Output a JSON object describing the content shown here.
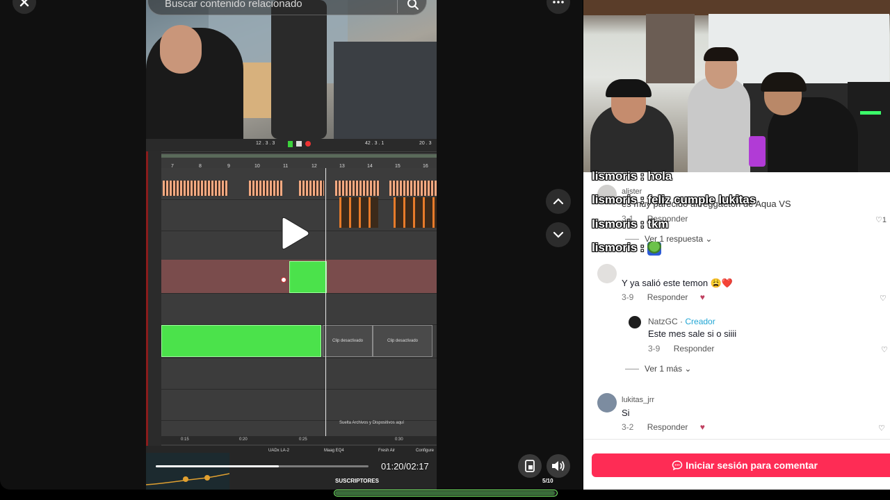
{
  "video": {
    "search_placeholder": "Buscar contenido relacionado",
    "time_current": "01:20",
    "time_total": "02:17",
    "progress": 0.58,
    "bottom_label": "SUSCRIPTORES",
    "page_counter": "5/10",
    "daw": {
      "ruler_ticks": [
        "7",
        "8",
        "9",
        "10",
        "11",
        "12",
        "13",
        "14",
        "15",
        "16"
      ],
      "clip_labels": [
        "Clip desactivado",
        "Clip desactivado"
      ],
      "drop_label": "Suelta Archivos y Dispositivos aquí",
      "bottom_ticks": [
        "0:15",
        "0:20",
        "0:25",
        "0:30"
      ],
      "transport_left": "12 . 3 . 3",
      "transport_right": "42 . 3 . 1",
      "transport_far": "20 . 3",
      "plugin_a": "UADx LA-2",
      "plugin_b": "Maag EQ4",
      "plugin_c": "Fresh Air",
      "plugin_c_sub": "Configure"
    }
  },
  "live_chat": [
    {
      "user": "lismoris",
      "message": "hola"
    },
    {
      "user": "lismoris",
      "message": "feliz cumple lukitas"
    },
    {
      "user": "lismoris",
      "message": "tkm"
    },
    {
      "user": "lismoris",
      "message": ""
    }
  ],
  "comments": [
    {
      "user": "alister",
      "text": "es muy parecido al reggaeton de Aqua VS",
      "date": "3-1",
      "reply_label": "Responder",
      "likes": "1",
      "view_replies": "Ver 1 respuesta"
    },
    {
      "user": "",
      "text": "Y ya salió este temon 😩❤️",
      "date": "3-9",
      "reply_label": "Responder",
      "replies": [
        {
          "user": "NatzGC",
          "badge": "Creador",
          "text": "Este mes sale si o siiii",
          "date": "3-9",
          "reply_label": "Responder"
        }
      ],
      "view_more": "Ver 1 más"
    },
    {
      "user": "lukitas_jrr",
      "text": "Si",
      "date": "3-2",
      "reply_label": "Responder"
    }
  ],
  "comment_cta": "Iniciar sesión para comentar",
  "colors": {
    "accent": "#fe2c55",
    "creator": "#20a5d4",
    "clip_green": "#4be24b"
  },
  "icons": [
    "close-icon",
    "more-icon",
    "search-icon",
    "play-icon",
    "chevron-up-icon",
    "chevron-down-icon",
    "pip-icon",
    "volume-icon",
    "heart-icon",
    "comment-icon"
  ]
}
